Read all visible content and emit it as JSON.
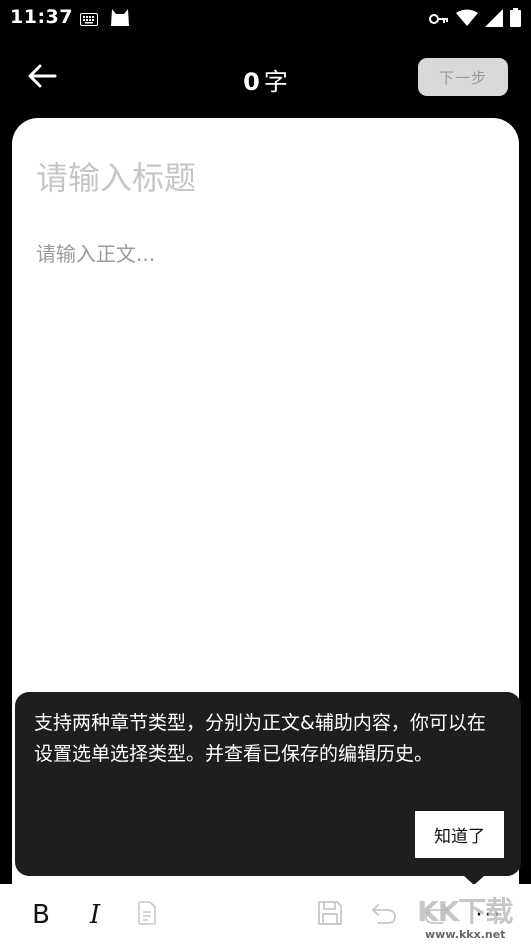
{
  "status_bar": {
    "time": "11:37",
    "icons": [
      "keyboard-icon",
      "cat-icon",
      "key-icon",
      "wifi-icon",
      "signal-icon",
      "battery-icon"
    ]
  },
  "header": {
    "word_count": "0",
    "word_unit": "字",
    "next_label": "下一步"
  },
  "editor": {
    "title_placeholder": "请输入标题",
    "title_value": "",
    "body_placeholder": "请输入正文...",
    "body_value": ""
  },
  "tooltip": {
    "text": "支持两种章节类型，分别为正文&辅助内容，你可以在设置选单选择类型。并查看已保存的编辑历史。",
    "confirm_label": "知道了"
  },
  "toolbar": {
    "bold_label": "B",
    "italic_label": "I",
    "more_label": "···"
  },
  "watermark": {
    "logo": "KK下载",
    "url": "www.kkx.net"
  },
  "colors": {
    "background": "#000000",
    "card": "#ffffff",
    "tooltip": "#1e1e1e",
    "disabled_button": "#d9d9d9"
  }
}
